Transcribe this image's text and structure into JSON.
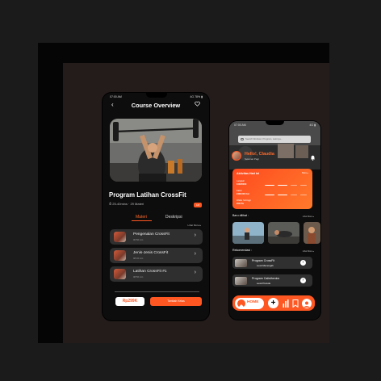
{
  "phone1": {
    "status_time": "07:00 AM",
    "status_right": "4G 78% ▮",
    "header_title": "Course Overview",
    "program_title": "Program Latihan CrossFit",
    "meta": "⏱ 25-40mins · 29 Materi",
    "badge": "4.8",
    "tabs": [
      "Materi",
      "Deskripsi"
    ],
    "see_all": "Lihat More ▸",
    "lessons": [
      {
        "title": "Pengenalan CrossFit",
        "duration": "00:56 min"
      },
      {
        "title": "Jenis-Jenis CrossFit",
        "duration": "08:32 min"
      },
      {
        "title": "Latihan CrossFit #1",
        "duration": "08:56 min"
      }
    ],
    "price": "Rp299K",
    "buy_label": "Tambah Kelas"
  },
  "phone2": {
    "status_time": "07:00 AM",
    "status_right": "4G ▮",
    "search_placeholder": "Search Workout, Program, Lainnya...",
    "greeting": "Hello!, Claudia",
    "greeting_sub": "Selamat Pagi",
    "activity": {
      "title": "Aktivitas Hari ini",
      "view_all": "More ▸",
      "rows": [
        {
          "label": "Langkah",
          "value": "1000/5000"
        },
        {
          "label": "Kalori",
          "value": "240/1000 Cal"
        },
        {
          "label": "Waktu Tertinggi",
          "value": "200 Pts"
        }
      ]
    },
    "rekomendasi_label": "Baru dilihat :",
    "rekomendasi_link": "Lihat More ▸",
    "recommendation_label": "Rekomendasi :",
    "recommendation_link": "Lihat More ▸",
    "recommendations": [
      {
        "title": "Program CrossFit",
        "level": "Level Menengah"
      },
      {
        "title": "Program Calisthenics",
        "level": "Level Pemula"
      }
    ],
    "nav_home": "HOME"
  },
  "colors": {
    "accent": "#ff5722",
    "card": "#2f2f2f",
    "bg": "#0d0d0d"
  }
}
